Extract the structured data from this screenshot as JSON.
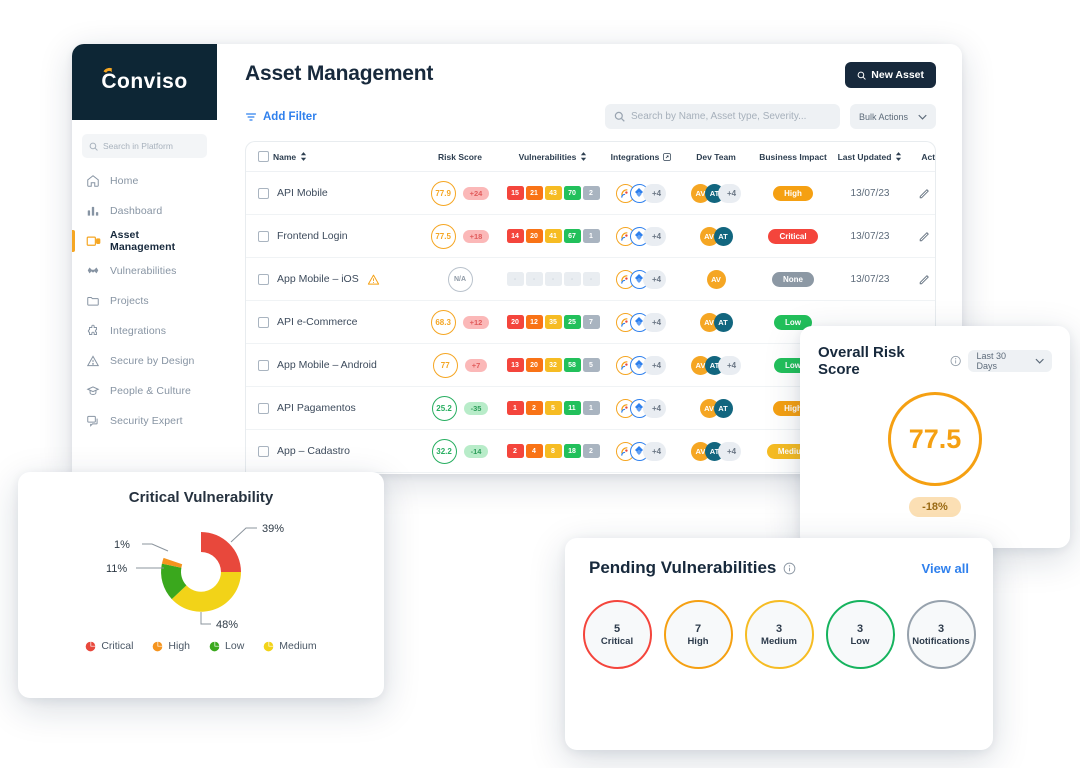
{
  "brand": {
    "name": "Conviso"
  },
  "sidebar": {
    "search_placeholder": "Search in Platform",
    "items": [
      {
        "label": "Home",
        "icon": "home-icon"
      },
      {
        "label": "Dashboard",
        "icon": "chart-bar-icon"
      },
      {
        "label": "Asset Management",
        "icon": "assets-icon"
      },
      {
        "label": "Vulnerabilities",
        "icon": "bug-icon"
      },
      {
        "label": "Projects",
        "icon": "folder-icon"
      },
      {
        "label": "Integrations",
        "icon": "puzzle-icon"
      },
      {
        "label": "Secure by Design",
        "icon": "shield-warning-icon"
      },
      {
        "label": "People & Culture",
        "icon": "graduation-cap-icon"
      },
      {
        "label": "Security Expert",
        "icon": "chat-icon"
      }
    ],
    "active_index": 2
  },
  "header": {
    "title": "Asset Management",
    "new_asset_label": "New Asset"
  },
  "toolbar": {
    "add_filter_label": "Add Filter",
    "search_placeholder": "Search by Name, Asset type, Severity...",
    "bulk_actions_label": "Bulk Actions"
  },
  "table": {
    "columns": [
      {
        "label": "Name",
        "sortable": true
      },
      {
        "label": "Risk Score",
        "sortable": false
      },
      {
        "label": "Vulnerabilities",
        "sortable": true
      },
      {
        "label": "Integrations",
        "sortable": false,
        "external": true
      },
      {
        "label": "Dev Team",
        "sortable": false
      },
      {
        "label": "Business Impact",
        "sortable": false
      },
      {
        "label": "Last Updated",
        "sortable": true
      },
      {
        "label": "Actions",
        "sortable": false
      }
    ],
    "integration_more": "+4",
    "rows": [
      {
        "name": "API Mobile",
        "warning": false,
        "score": "77.9",
        "score_color": "orange",
        "delta": "+24",
        "delta_dir": "up",
        "vulns": [
          "15",
          "21",
          "43",
          "70",
          "2"
        ],
        "team": [
          "AV",
          "AT"
        ],
        "team_more": "+4",
        "impact": "High",
        "impact_class": "high",
        "updated": "13/07/23"
      },
      {
        "name": "Frontend Login",
        "warning": false,
        "score": "77.5",
        "score_color": "orange",
        "delta": "+18",
        "delta_dir": "up",
        "vulns": [
          "14",
          "20",
          "41",
          "67",
          "1"
        ],
        "team": [
          "AV",
          "AT"
        ],
        "team_more": "",
        "impact": "Critical",
        "impact_class": "critical",
        "updated": "13/07/23"
      },
      {
        "name": "App Mobile – iOS",
        "warning": true,
        "score": "N/A",
        "score_color": "grey",
        "delta": "",
        "delta_dir": "",
        "vulns": [
          "-",
          "-",
          "-",
          "-",
          "-"
        ],
        "team": [
          "AV"
        ],
        "team_more": "",
        "impact": "None",
        "impact_class": "none",
        "updated": "13/07/23"
      },
      {
        "name": "API e-Commerce",
        "warning": false,
        "score": "68.3",
        "score_color": "orange",
        "delta": "+12",
        "delta_dir": "up",
        "vulns": [
          "20",
          "12",
          "35",
          "25",
          "7"
        ],
        "team": [
          "AV",
          "AT"
        ],
        "team_more": "",
        "impact": "Low",
        "impact_class": "low",
        "updated": ""
      },
      {
        "name": "App Mobile – Android",
        "warning": false,
        "score": "77",
        "score_color": "orange",
        "delta": "+7",
        "delta_dir": "up",
        "vulns": [
          "13",
          "20",
          "32",
          "58",
          "5"
        ],
        "team": [
          "AV",
          "AT"
        ],
        "team_more": "+4",
        "impact": "Low",
        "impact_class": "low",
        "updated": ""
      },
      {
        "name": "API Pagamentos",
        "warning": false,
        "score": "25.2",
        "score_color": "green",
        "delta": "-35",
        "delta_dir": "down",
        "vulns": [
          "1",
          "2",
          "5",
          "11",
          "1"
        ],
        "team": [
          "AV",
          "AT"
        ],
        "team_more": "",
        "impact": "High",
        "impact_class": "high",
        "updated": ""
      },
      {
        "name": "App – Cadastro",
        "warning": false,
        "score": "32.2",
        "score_color": "green",
        "delta": "-14",
        "delta_dir": "down",
        "vulns": [
          "2",
          "4",
          "8",
          "18",
          "2"
        ],
        "team": [
          "AV",
          "AT"
        ],
        "team_more": "+4",
        "impact": "Medium",
        "impact_class": "medium",
        "updated": ""
      }
    ]
  },
  "risk_card": {
    "title": "Overall Risk Score",
    "period_label": "Last 30 Days",
    "score": "77.5",
    "delta": "-18%",
    "ring_color": "#f5a012"
  },
  "pending_card": {
    "title": "Pending Vulnerabilities",
    "view_all_label": "View all",
    "items": [
      {
        "value": "5",
        "label": "Critical",
        "color": "#f4453c"
      },
      {
        "value": "7",
        "label": "High",
        "color": "#f5a012"
      },
      {
        "value": "3",
        "label": "Medium",
        "color": "#f6bc23"
      },
      {
        "value": "3",
        "label": "Low",
        "color": "#16b35e"
      },
      {
        "value": "3",
        "label": "Notifications",
        "color": "#97a2ad"
      }
    ]
  },
  "chart_data": {
    "type": "pie",
    "title": "Critical Vulnerability",
    "labels": [
      "Critical",
      "Medium",
      "Low",
      "High"
    ],
    "values": [
      39,
      48,
      11,
      1
    ],
    "value_labels": [
      "39%",
      "48%",
      "11%",
      "1%"
    ],
    "colors": [
      "#e8483c",
      "#f2d318",
      "#3aa81d",
      "#f5941e"
    ],
    "legend": [
      {
        "label": "Critical",
        "color": "#e8483c"
      },
      {
        "label": "High",
        "color": "#f5941e"
      },
      {
        "label": "Low",
        "color": "#3aa81d"
      },
      {
        "label": "Medium",
        "color": "#f2d318"
      }
    ],
    "legend_position": "bottom",
    "donut": true,
    "grid": false
  }
}
